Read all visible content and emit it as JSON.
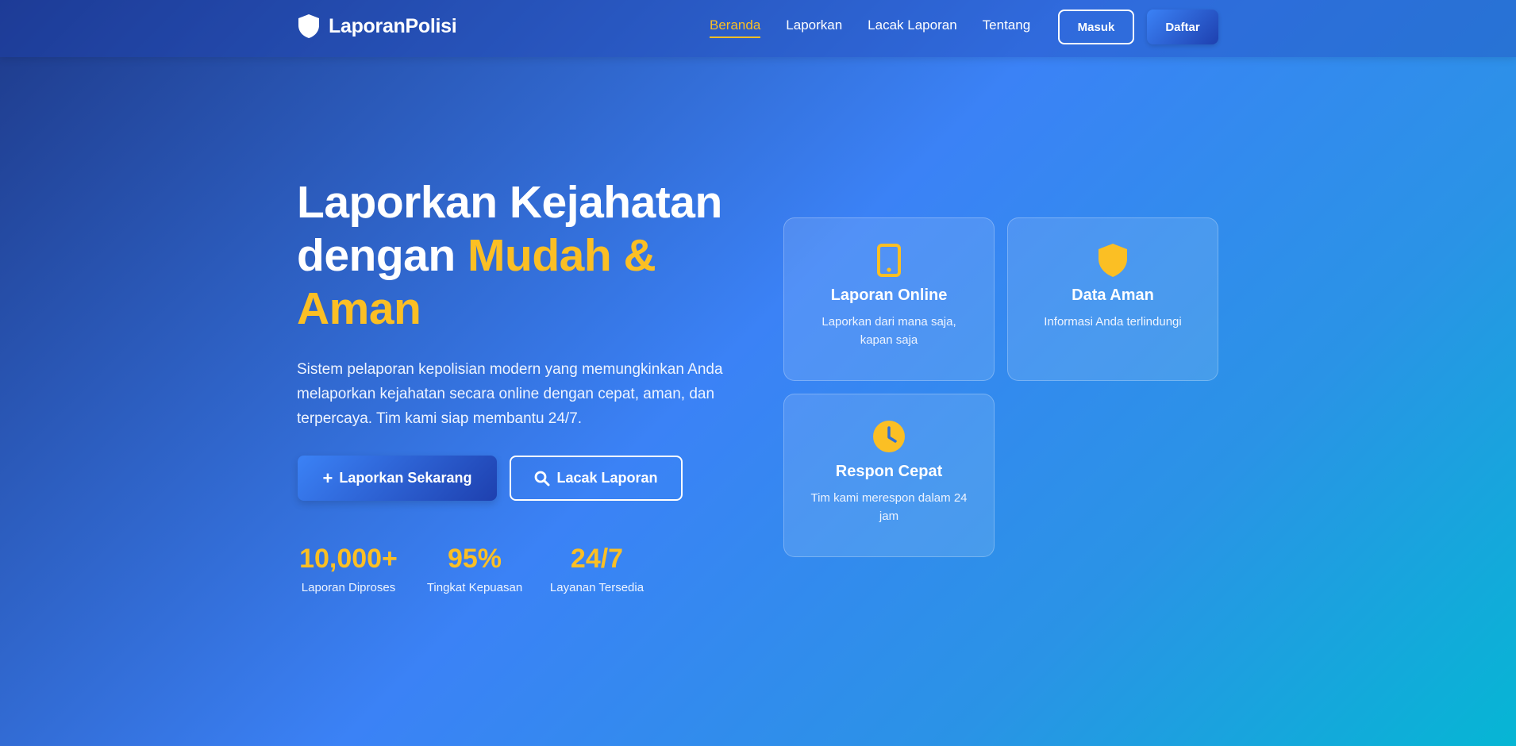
{
  "colors": {
    "accent": "#fbbf24",
    "primary": "#3b82f6",
    "primary_dark": "#1e40af",
    "gradient_end": "#06b6d4"
  },
  "nav": {
    "brand": "LaporanPolisi",
    "links": [
      "Beranda",
      "Laporkan",
      "Lacak Laporan",
      "Tentang"
    ],
    "active_link": "Beranda",
    "login_label": "Masuk",
    "register_label": "Daftar"
  },
  "hero": {
    "title_line1": "Laporkan Kejahatan",
    "title_line2_prefix": "dengan",
    "title_highlight": "Mudah & Aman",
    "description": "Sistem pelaporan kepolisian modern yang memungkinkan Anda melaporkan kejahatan secara online dengan cepat, aman, dan terpercaya. Tim kami siap membantu 24/7.",
    "primary_button": "Laporkan Sekarang",
    "secondary_button": "Lacak Laporan",
    "icons": {
      "primary_button": "plus-icon",
      "secondary_button": "search-icon"
    }
  },
  "stats": [
    {
      "value": "10,000+",
      "label": "Laporan Diproses"
    },
    {
      "value": "95%",
      "label": "Tingkat Kepuasan"
    },
    {
      "value": "24/7",
      "label": "Layanan Tersedia"
    }
  ],
  "features": [
    {
      "icon": "mobile-phone-icon",
      "title": "Laporan Online",
      "description": "Laporkan dari mana saja, kapan saja"
    },
    {
      "icon": "shield-icon",
      "title": "Data Aman",
      "description": "Informasi Anda terlindungi"
    },
    {
      "icon": "clock-icon",
      "title": "Respon Cepat",
      "description": "Tim kami merespon dalam 24 jam"
    }
  ]
}
